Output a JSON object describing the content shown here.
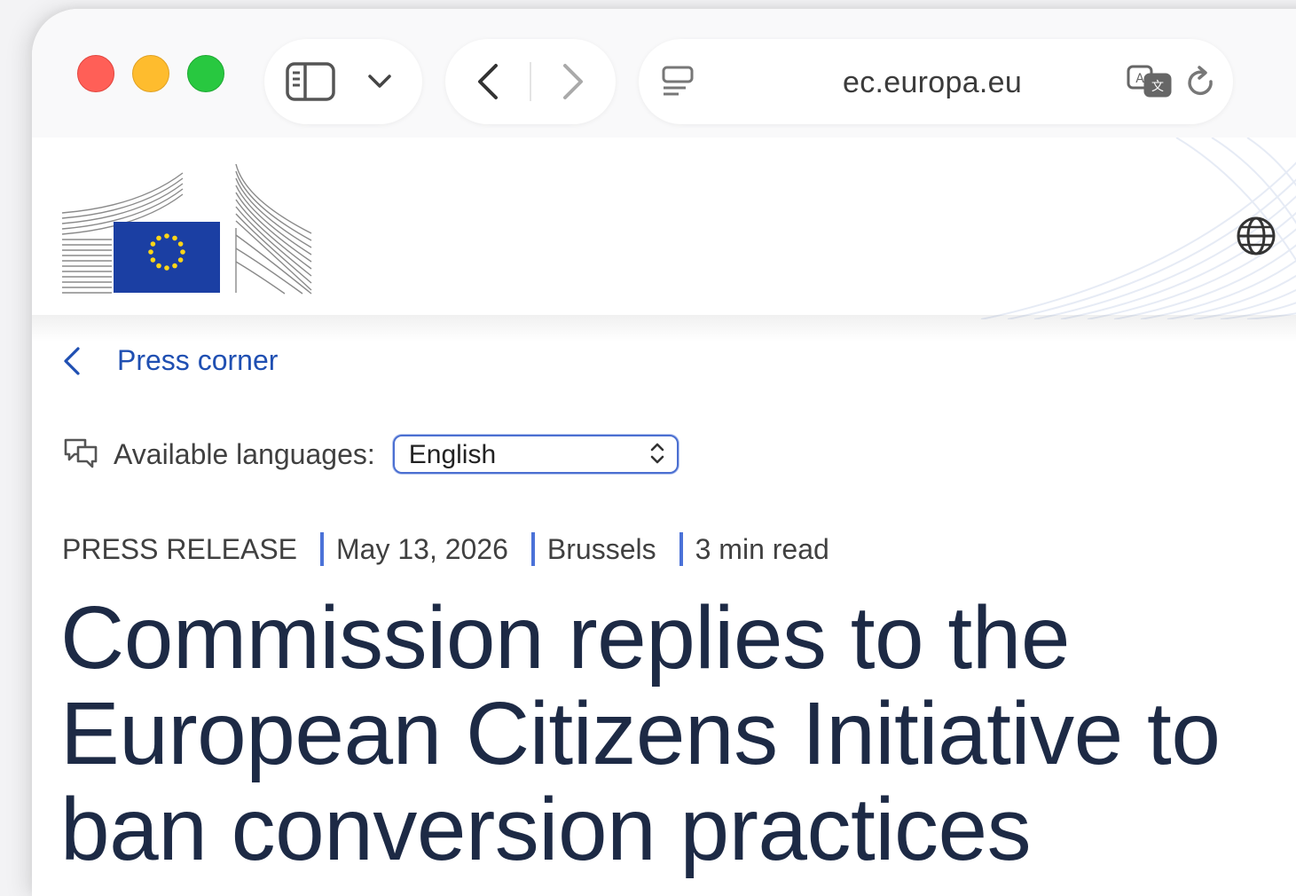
{
  "browser": {
    "url": "ec.europa.eu",
    "icons": {
      "sidebar": "sidebar-icon",
      "dropdown": "chevron-down-icon",
      "back": "chevron-left-icon",
      "forward": "chevron-right-icon",
      "page_menu": "page-menu-icon",
      "translate": "translate-icon",
      "reload": "reload-icon"
    }
  },
  "site_header": {
    "logo": "european-commission-logo",
    "language_icon": "globe-icon"
  },
  "breadcrumb": {
    "label": "Press corner"
  },
  "languages": {
    "label": "Available languages:",
    "selected": "English"
  },
  "meta": {
    "type": "PRESS RELEASE",
    "date": "May 13, 2026",
    "location": "Brussels",
    "read_time": "3 min read"
  },
  "headline": {
    "line1": "Commission replies to the",
    "line2": "European Citizens Initiative to",
    "line3": "ban conversion practices"
  },
  "colors": {
    "link": "#1f4fb2",
    "accent": "#4b72d8",
    "headline": "#1d2a45",
    "eu_blue": "#1b3fa3",
    "eu_star": "#ffd617"
  }
}
